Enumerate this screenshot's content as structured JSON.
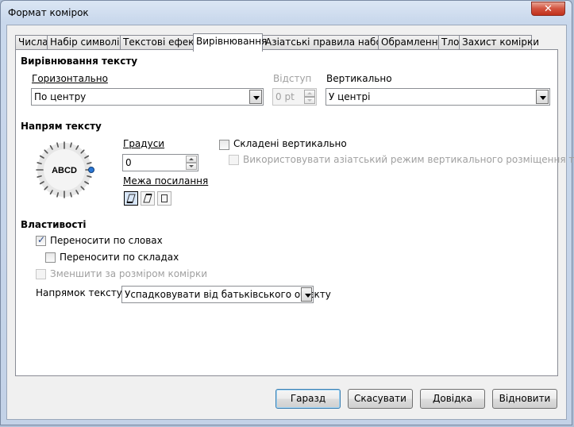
{
  "window": {
    "title": "Формат комірок",
    "close_label": "✕"
  },
  "tabs": [
    {
      "label": "Числа"
    },
    {
      "label": "Набір символів"
    },
    {
      "label": "Текстові ефекти"
    },
    {
      "label": "Вирівнювання"
    },
    {
      "label": "Азіатські правила набору"
    },
    {
      "label": "Обрамлення"
    },
    {
      "label": "Тло"
    },
    {
      "label": "Захист комірки"
    }
  ],
  "active_tab": "Вирівнювання",
  "text_alignment": {
    "header": "Вирівнювання тексту",
    "horizontal_label": "Горизонтально",
    "horizontal_value": "По центру",
    "indent_label": "Відступ",
    "indent_value": "0 pt",
    "vertical_label": "Вертикально",
    "vertical_value": "У центрі"
  },
  "text_orientation": {
    "header": "Напрям тексту",
    "dial_text": "ABCD",
    "degrees_label": "Градуси",
    "degrees_value": "0",
    "reference_edge_label": "Межа посилання",
    "reference_edge_selected": 0,
    "vertically_stacked_label": "Складені вертикально",
    "vertically_stacked_checked": false,
    "asian_layout_label": "Використовувати азіатський режим вертикального розміщення тексту",
    "asian_layout_checked": false
  },
  "properties": {
    "header": "Властивості",
    "wrap_words_label": "Переносити по словах",
    "wrap_words_checked": true,
    "hyphenation_label": "Переносити по складах",
    "hyphenation_checked": false,
    "shrink_label": "Зменшити за розміром комірки",
    "shrink_checked": false,
    "text_direction_label": "Напрямок тексту",
    "text_direction_value": "Успадковувати від батьківського об'єкту"
  },
  "buttons": {
    "ok": "Гаразд",
    "cancel": "Скасувати",
    "help": "Довідка",
    "reset": "Відновити"
  },
  "colors": {
    "accent": "#3c7fb1",
    "check": "#2d4c8a",
    "title_gradient_top": "#dbe6f4"
  }
}
